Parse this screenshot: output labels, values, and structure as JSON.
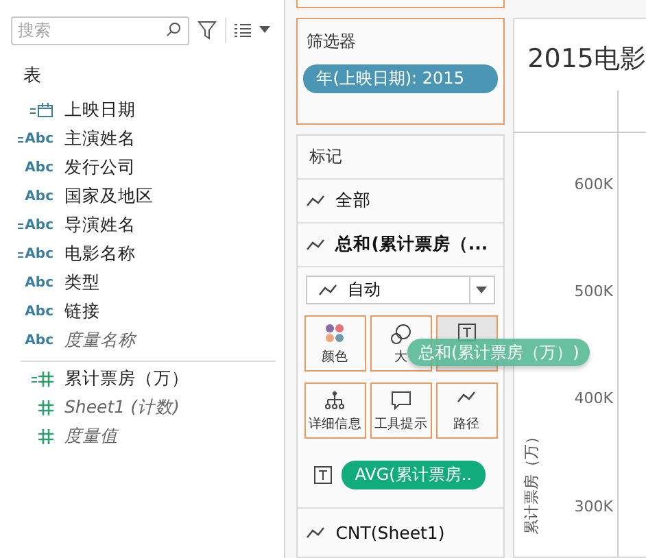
{
  "search": {
    "placeholder": "搜索"
  },
  "data_pane": {
    "heading": "表",
    "fields": [
      {
        "name": "上映日期",
        "kind": "date",
        "calculated": true,
        "generated": false
      },
      {
        "name": "主演姓名",
        "kind": "text",
        "type_label": "Abc",
        "calculated": true,
        "generated": false
      },
      {
        "name": "发行公司",
        "kind": "text",
        "type_label": "Abc",
        "calculated": false,
        "generated": false
      },
      {
        "name": "国家及地区",
        "kind": "text",
        "type_label": "Abc",
        "calculated": false,
        "generated": false
      },
      {
        "name": "导演姓名",
        "kind": "text",
        "type_label": "Abc",
        "calculated": true,
        "generated": false
      },
      {
        "name": "电影名称",
        "kind": "text",
        "type_label": "Abc",
        "calculated": true,
        "generated": false
      },
      {
        "name": "类型",
        "kind": "text",
        "type_label": "Abc",
        "calculated": false,
        "generated": false
      },
      {
        "name": "链接",
        "kind": "text",
        "type_label": "Abc",
        "calculated": false,
        "generated": false
      },
      {
        "name": "度量名称",
        "kind": "text",
        "type_label": "Abc",
        "calculated": false,
        "generated": true
      }
    ],
    "measures": [
      {
        "name": "累计票房（万）",
        "kind": "number",
        "calculated": true,
        "generated": false
      },
      {
        "name": "Sheet1 (计数)",
        "kind": "number",
        "calculated": false,
        "generated": true
      },
      {
        "name": "度量值",
        "kind": "number",
        "calculated": false,
        "generated": true
      }
    ]
  },
  "filters": {
    "title": "筛选器",
    "pills": [
      "年(上映日期): 2015"
    ]
  },
  "marks": {
    "title": "标记",
    "sections": [
      {
        "label": "全部",
        "bold": false
      },
      {
        "label": "总和(累计票房（...",
        "bold": true
      }
    ],
    "mark_type": "自动",
    "buttons": [
      {
        "kind": "color",
        "label": "颜色",
        "highlighted": false
      },
      {
        "kind": "size",
        "label": "大",
        "highlighted": false
      },
      {
        "kind": "label",
        "highlighted": true
      },
      {
        "kind": "detail",
        "label": "详细信息",
        "highlighted": false
      },
      {
        "kind": "tooltip",
        "label": "工具提示",
        "highlighted": false
      },
      {
        "kind": "path",
        "label": "路径",
        "highlighted": false
      }
    ],
    "label_pill": "AVG(累计票房..",
    "last_section": "CNT(Sheet1)"
  },
  "chart": {
    "title": "2015电影",
    "axis_title": "累计票房（万）",
    "ticks": [
      "600K",
      "500K",
      "400K",
      "300K"
    ]
  },
  "dragging_pill": {
    "label": "总和(累计票房（万）)"
  }
}
